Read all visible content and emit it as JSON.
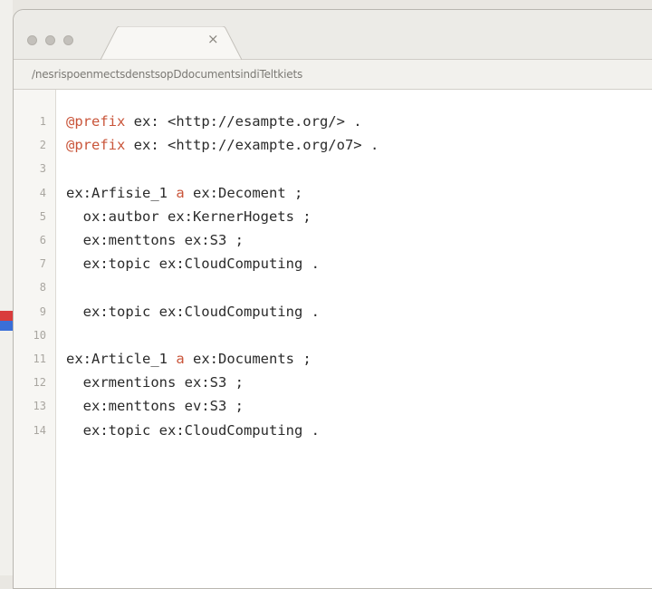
{
  "window": {
    "tab_close": "×",
    "path": "/nesrispoenmectsdenstsopDdocumentsindiTeltkiets"
  },
  "editor": {
    "lines": [
      {
        "num": "1",
        "parts": [
          {
            "t": "@prefix",
            "kw": true
          },
          {
            "t": " ex: <http://esampte.org/> ."
          }
        ]
      },
      {
        "num": "2",
        "parts": [
          {
            "t": "@prefix",
            "kw": true
          },
          {
            "t": " ex: <http://exampte.org/o7> ."
          }
        ]
      },
      {
        "num": "3",
        "parts": []
      },
      {
        "num": "4",
        "parts": [
          {
            "t": "ex:Arfisie_1 "
          },
          {
            "t": "a",
            "kw": true
          },
          {
            "t": " ex:Decoment ;"
          }
        ]
      },
      {
        "num": "5",
        "parts": [
          {
            "t": "  ox:autbor ex:KernerHogets ;"
          }
        ]
      },
      {
        "num": "6",
        "parts": [
          {
            "t": "  ex:menttons ex:S3 ;"
          }
        ]
      },
      {
        "num": "7",
        "parts": [
          {
            "t": "  ex:topic ex:CloudComputing ."
          }
        ]
      },
      {
        "num": "8",
        "parts": []
      },
      {
        "num": "9",
        "parts": [
          {
            "t": "  ex:topic ex:CloudComputing ."
          }
        ]
      },
      {
        "num": "10",
        "parts": []
      },
      {
        "num": "11",
        "parts": [
          {
            "t": "ex:Article_1 "
          },
          {
            "t": "a",
            "kw": true
          },
          {
            "t": " ex:Documents ;"
          }
        ]
      },
      {
        "num": "12",
        "parts": [
          {
            "t": "  exrmentions ex:S3 ;"
          }
        ]
      },
      {
        "num": "13",
        "parts": [
          {
            "t": "  ex:menttons ev:S3 ;"
          }
        ]
      },
      {
        "num": "14",
        "parts": [
          {
            "t": "  ex:topic ex:CloudComputing ."
          }
        ]
      }
    ]
  },
  "colors": {
    "keyword": "#c9553a",
    "text": "#2b2b2b",
    "line_number": "#a9a6a0",
    "marker_red": "#d93c3c",
    "marker_blue": "#3a6fd8"
  }
}
